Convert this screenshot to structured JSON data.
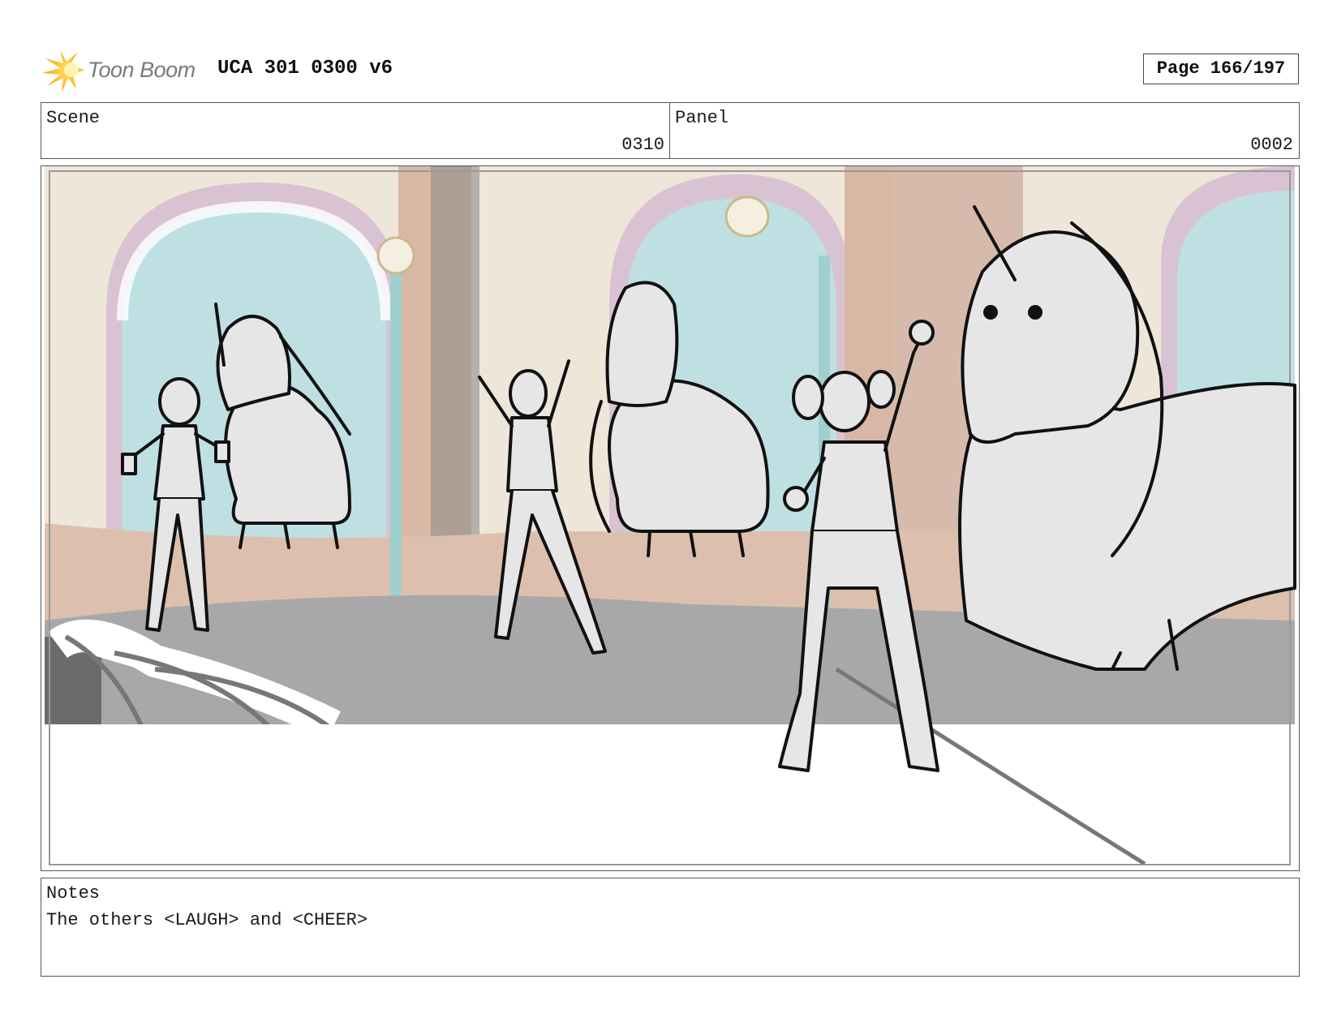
{
  "header": {
    "logo_text": "Toon Boom",
    "document_title": "UCA 301 0300 v6",
    "page_indicator": "Page 166/197"
  },
  "info": {
    "scene_label": "Scene",
    "scene_value": "0310",
    "panel_label": "Panel",
    "panel_value": "0002"
  },
  "notes": {
    "label": "Notes",
    "text": "The others <LAUGH> and <CHEER>"
  },
  "colors": {
    "wall": "#efe6da",
    "pillar": "#d8b8a4",
    "window_glass": "#bfe0e3",
    "arch_trim": "#d9c3d2",
    "floor": "#a8a8a8",
    "lamp_post": "#9fcfcf",
    "sketch_fill": "#e6e6e6",
    "sketch_line": "#111111"
  },
  "icons": {
    "logo": "toon-boom-starburst-icon"
  }
}
